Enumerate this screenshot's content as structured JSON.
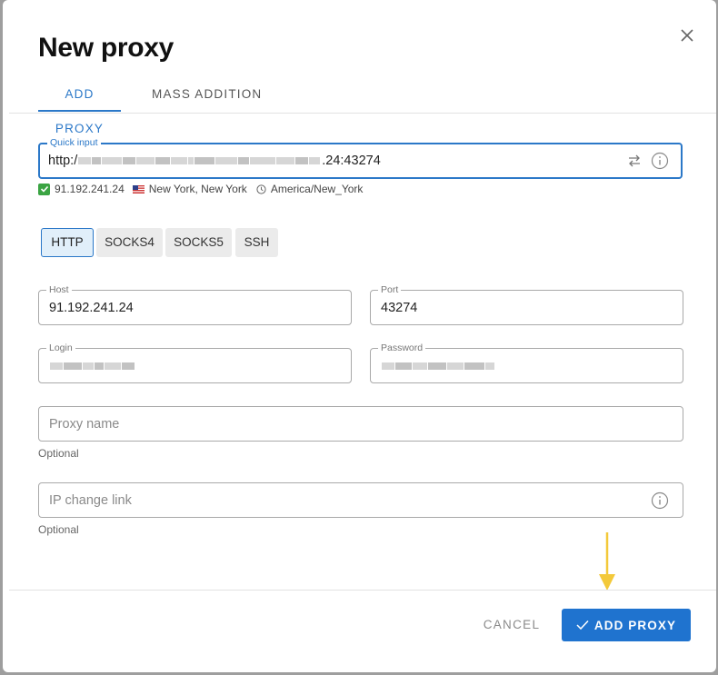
{
  "dialog": {
    "title": "New proxy"
  },
  "tabs": [
    {
      "label": "ADD PROXY",
      "active": true
    },
    {
      "label": "MASS ADDITION",
      "active": false
    }
  ],
  "quick_input": {
    "label": "Quick input",
    "value_prefix": "http:/",
    "value_suffix": ".24:43274"
  },
  "detected": {
    "ip": "91.192.241.24",
    "location": "New York, New York",
    "timezone": "America/New_York"
  },
  "protocols": [
    {
      "label": "HTTP",
      "active": true
    },
    {
      "label": "SOCKS4",
      "active": false
    },
    {
      "label": "SOCKS5",
      "active": false
    },
    {
      "label": "SSH",
      "active": false
    }
  ],
  "host": {
    "label": "Host",
    "value": "91.192.241.24"
  },
  "port": {
    "label": "Port",
    "value": "43274"
  },
  "login": {
    "label": "Login"
  },
  "password": {
    "label": "Password"
  },
  "proxy_name": {
    "placeholder": "Proxy name",
    "hint": "Optional"
  },
  "ip_change_link": {
    "placeholder": "IP change link",
    "hint": "Optional"
  },
  "footer": {
    "cancel_label": "CANCEL",
    "add_label": "ADD PROXY"
  },
  "colors": {
    "accent": "#2b78c8",
    "primary_button": "#1f73cf",
    "success": "#3ba443",
    "annotation_arrow": "#f3c93a"
  }
}
